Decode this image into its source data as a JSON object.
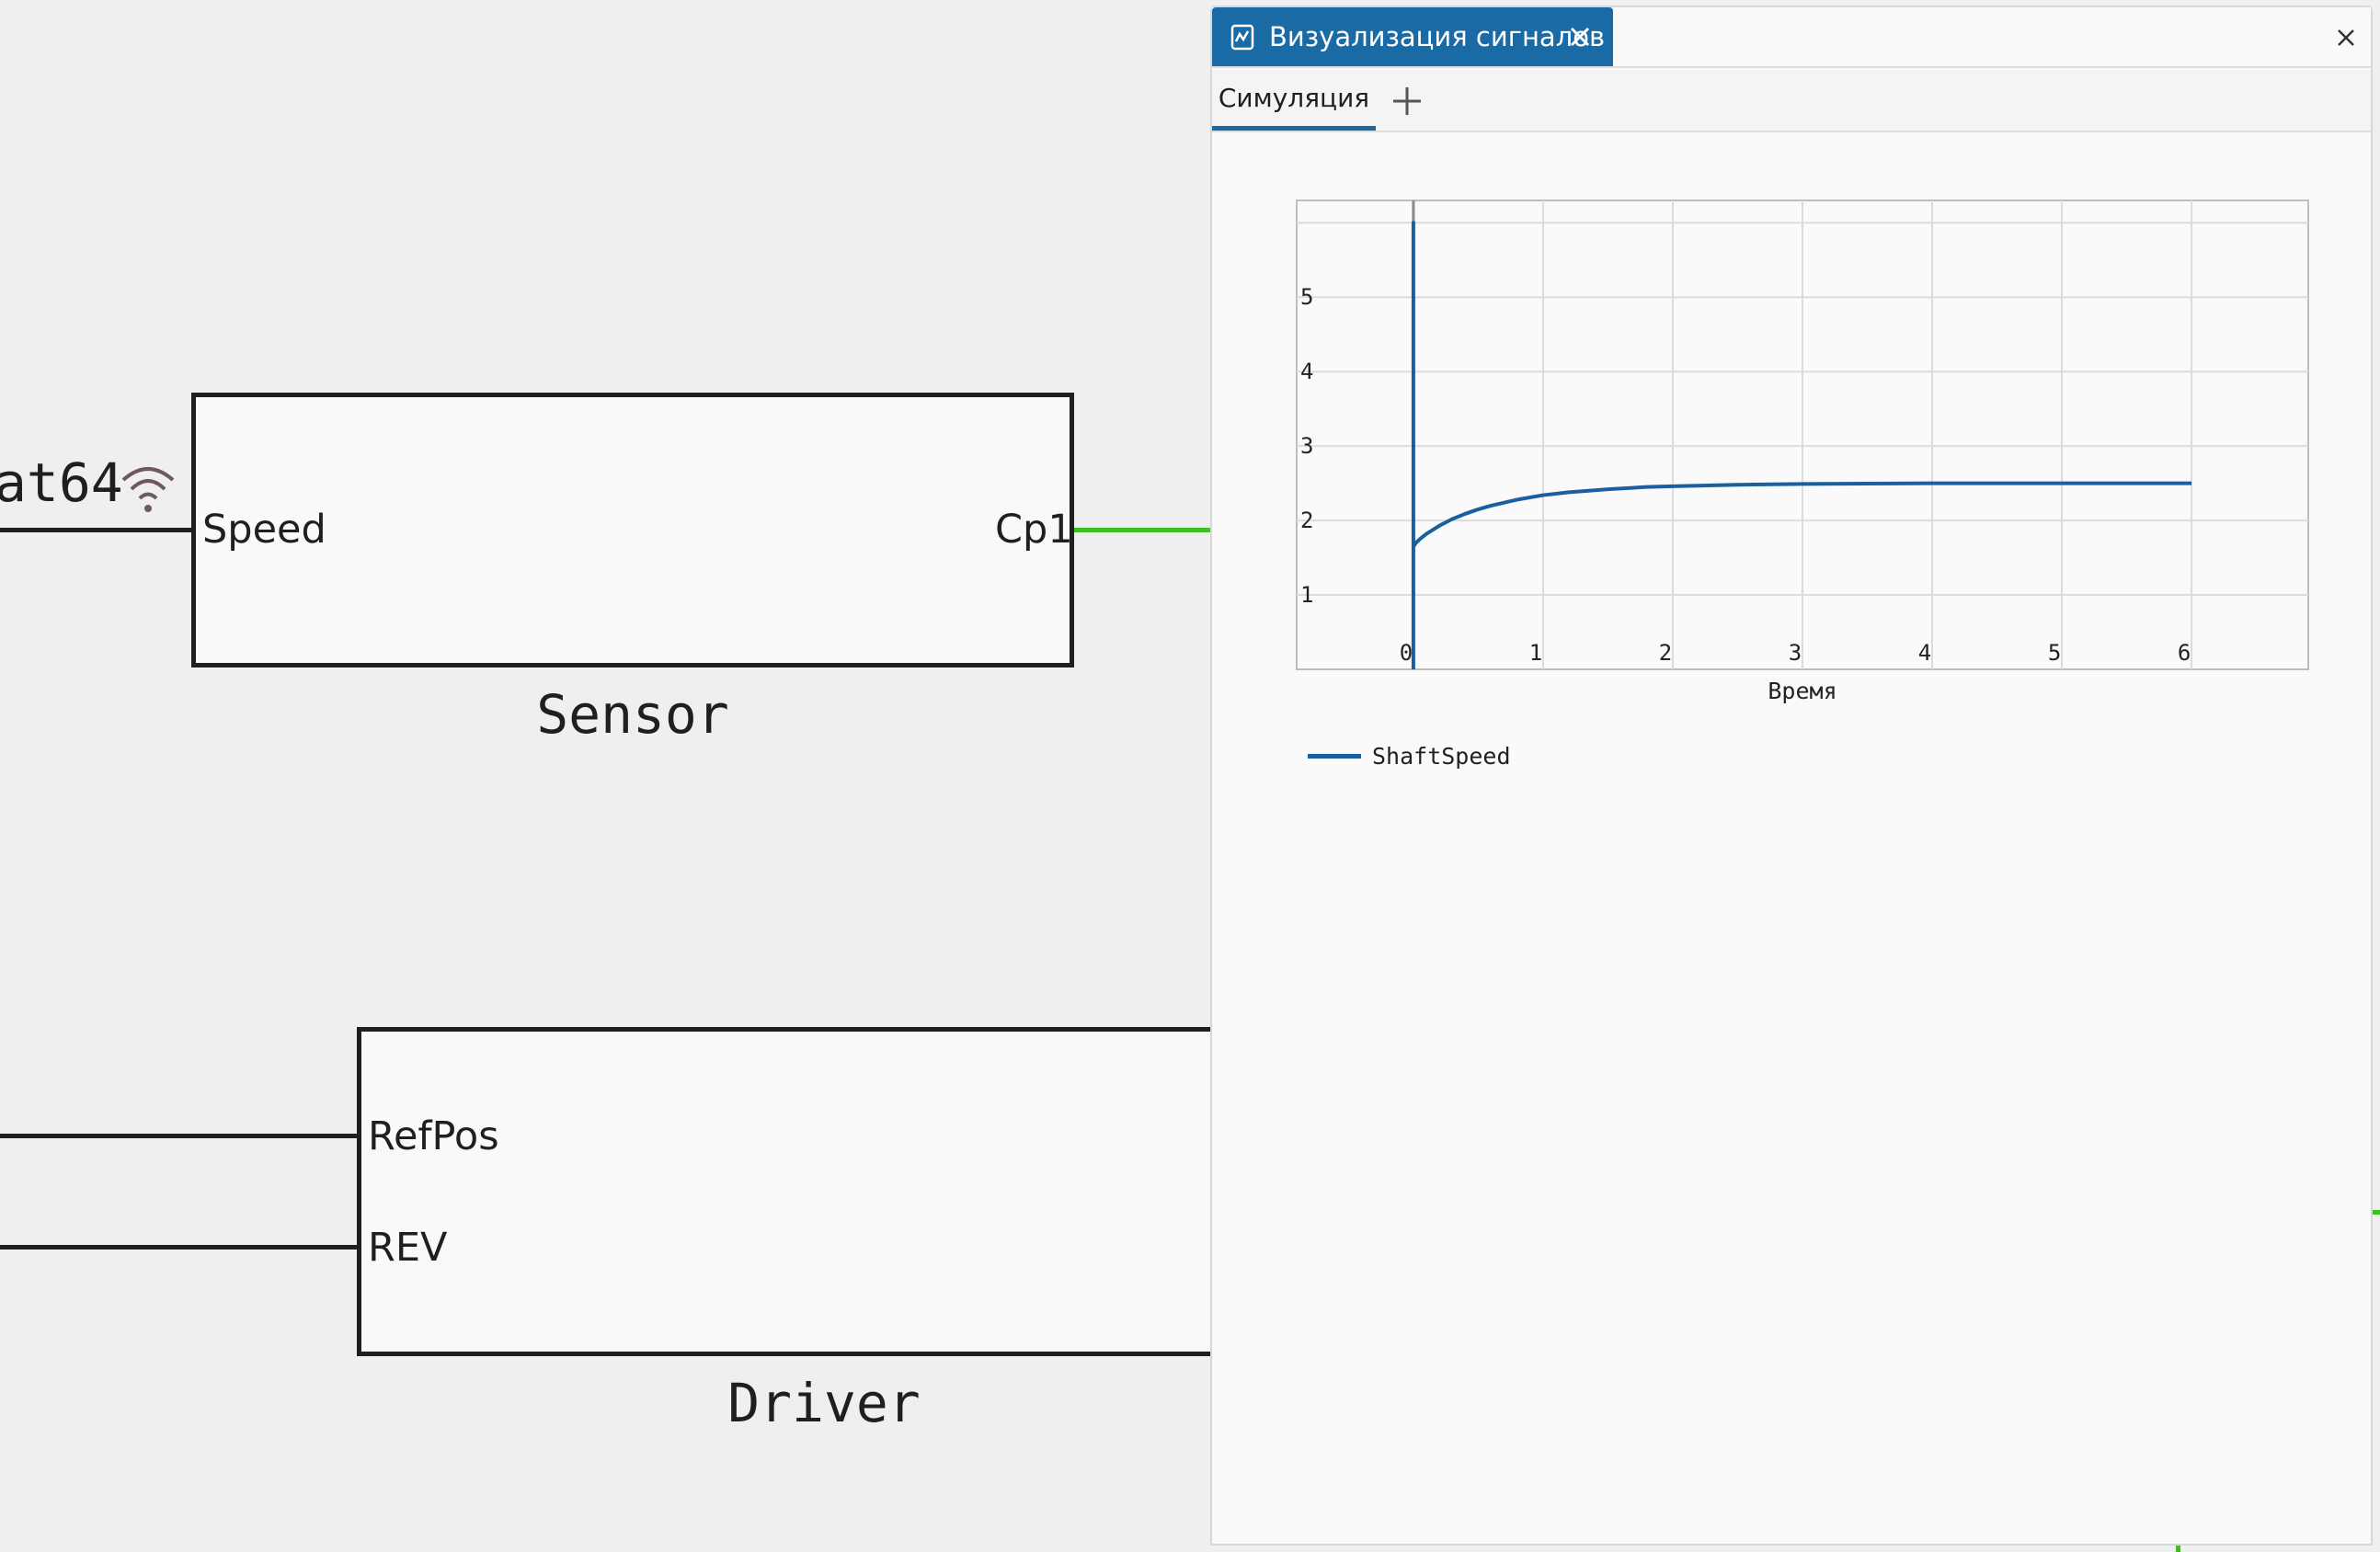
{
  "diagram": {
    "partial_label": "at64",
    "sensor": {
      "name": "Sensor",
      "port_in": "Speed",
      "port_out": "Cp1"
    },
    "driver": {
      "name": "Driver",
      "port_in_1": "RefPos",
      "port_in_2": "REV"
    },
    "icons": [
      "wifi-icon"
    ]
  },
  "panel": {
    "title": "Визуализация сигналов",
    "tab_icon": "signal-chart-icon",
    "tab_close_icon": "close-icon",
    "close_icon": "close-icon",
    "subtabs": [
      {
        "label": "Симуляция",
        "active": true
      }
    ],
    "add_tab_icon": "plus-icon"
  },
  "chart_data": {
    "type": "line",
    "xlabel": "Время",
    "ylabel": "",
    "x_ticks": [
      "0",
      "1",
      "2",
      "3",
      "4",
      "5",
      "6"
    ],
    "y_ticks": [
      "1",
      "2",
      "3",
      "4",
      "5"
    ],
    "xlim": [
      -0.9,
      6.9
    ],
    "ylim": [
      0,
      6.3
    ],
    "grid": true,
    "legend": "bottom-left",
    "series": [
      {
        "name": "ShaftSpeed",
        "color": "#1a5fa0",
        "x": [
          0,
          0,
          0,
          0.02,
          0.05,
          0.1,
          0.2,
          0.3,
          0.4,
          0.5,
          0.6,
          0.8,
          1.0,
          1.2,
          1.5,
          1.8,
          2.0,
          2.5,
          3.0,
          3.5,
          4.0,
          4.5,
          5.0,
          5.5,
          6.0
        ],
        "y": [
          0,
          6.0,
          1.65,
          1.7,
          1.75,
          1.82,
          1.93,
          2.02,
          2.09,
          2.15,
          2.2,
          2.28,
          2.34,
          2.38,
          2.42,
          2.45,
          2.46,
          2.48,
          2.49,
          2.495,
          2.5,
          2.5,
          2.5,
          2.5,
          2.5
        ]
      }
    ]
  }
}
